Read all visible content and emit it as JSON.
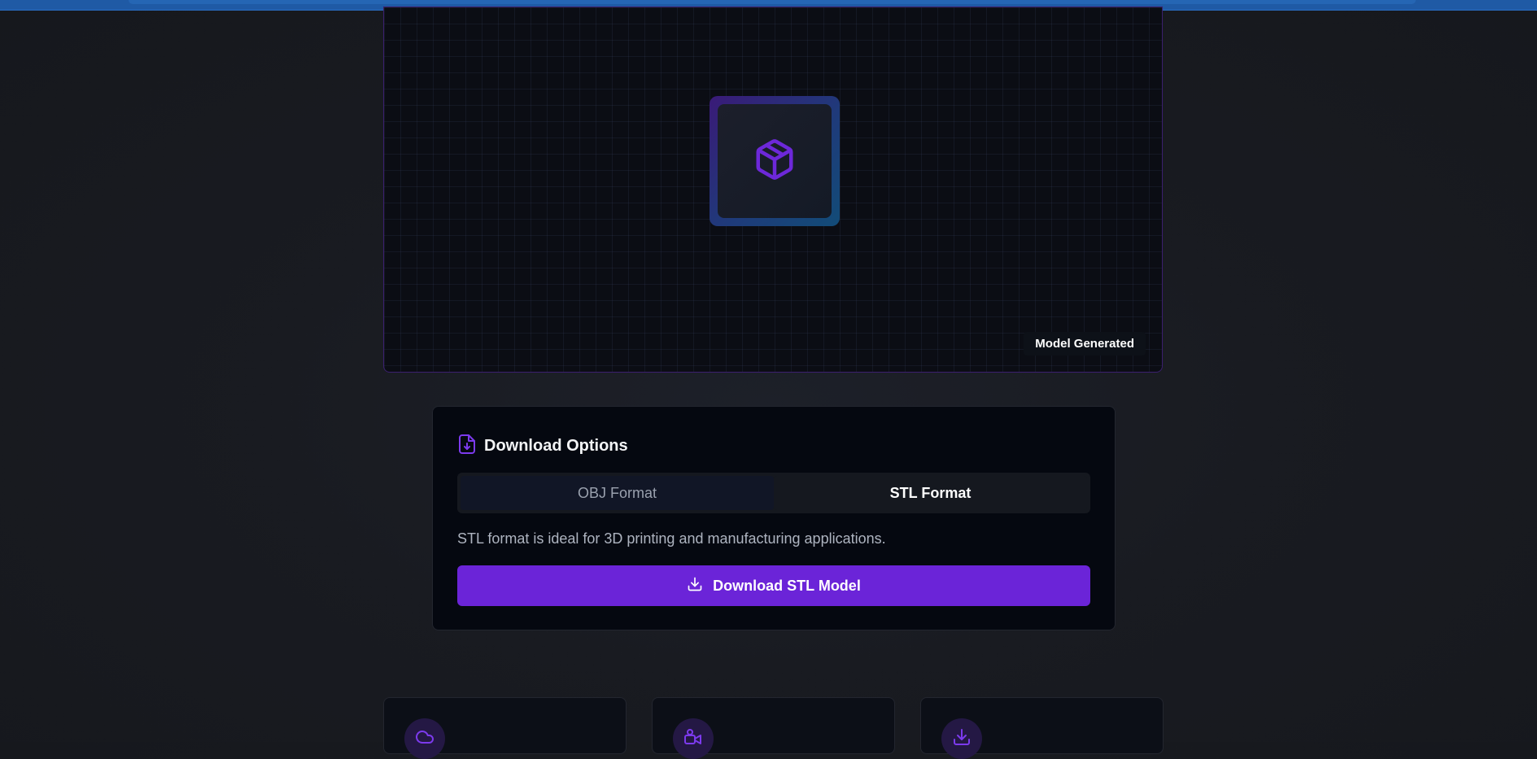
{
  "viewer": {
    "badge": "Model Generated",
    "center_icon": "package-cube-icon"
  },
  "download": {
    "title": "Download Options",
    "title_icon": "file-download-icon",
    "tabs": [
      {
        "label": "OBJ Format",
        "active": false
      },
      {
        "label": "STL Format",
        "active": true
      }
    ],
    "description": "STL format is ideal for 3D printing and manufacturing applications.",
    "button_label": "Download STL Model",
    "button_icon": "download-icon"
  },
  "features": [
    {
      "icon": "cloud-icon"
    },
    {
      "icon": "user-video-icon"
    },
    {
      "icon": "download-icon"
    }
  ],
  "colors": {
    "accent": "#6b24d8",
    "icon_purple": "#6d28d9",
    "card_bg": "#050810",
    "page_bg": "#191b21",
    "topbar": "#1f5aa5"
  }
}
